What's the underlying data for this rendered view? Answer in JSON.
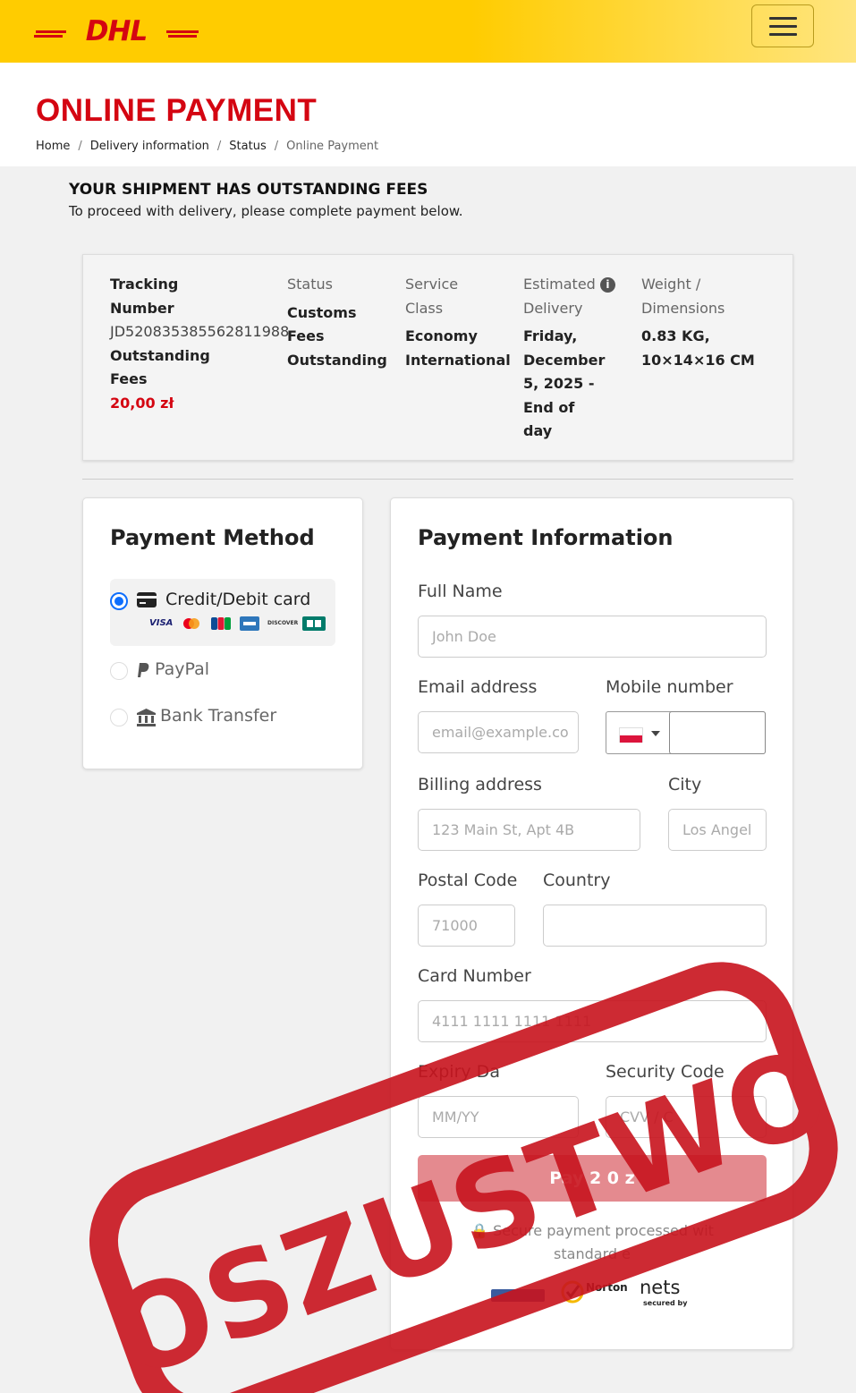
{
  "header": {
    "logo_text": "DHL",
    "menu_icon": "hamburger-icon"
  },
  "page": {
    "title": "ONLINE PAYMENT",
    "breadcrumb": [
      "Home",
      "Delivery information",
      "Status",
      "Online Payment"
    ]
  },
  "notice": {
    "title": "YOUR SHIPMENT HAS OUTSTANDING FEES",
    "text": "To proceed with delivery, please complete payment below."
  },
  "shipment": {
    "tracking_label_1": "Tracking",
    "tracking_label_2": "Number",
    "tracking_number": "JD520835385562811988",
    "fees_label_1": "Outstanding",
    "fees_label_2": "Fees",
    "fees_value": "20,00 zł",
    "status_label": "Status",
    "status_value_1": "Customs",
    "status_value_2": "Fees",
    "status_value_3": "Outstanding",
    "service_label_1": "Service",
    "service_label_2": "Class",
    "service_value_1": "Economy",
    "service_value_2": "International",
    "delivery_label_1": "Estimated",
    "delivery_label_2": "Delivery",
    "delivery_value": [
      "Friday,",
      "December",
      "5, 2025 -",
      "End of",
      "day"
    ],
    "weight_label_1": "Weight /",
    "weight_label_2": "Dimensions",
    "weight_value_1": "0.83 KG,",
    "weight_value_2": "10×14×16 CM"
  },
  "payment_method": {
    "title": "Payment Method",
    "options": [
      {
        "label": "Credit/Debit card",
        "icon": "credit-card-icon",
        "selected": true
      },
      {
        "label": "PayPal",
        "icon": "paypal-icon",
        "selected": false
      },
      {
        "label": "Bank Transfer",
        "icon": "bank-icon",
        "selected": false
      }
    ],
    "card_brands": [
      "VISA",
      "DISCOVER"
    ]
  },
  "payment_info": {
    "title": "Payment Information",
    "full_name_label": "Full Name",
    "full_name_placeholder": "John Doe",
    "email_label": "Email address",
    "email_placeholder": "email@example.co",
    "mobile_label": "Mobile number",
    "billing_label": "Billing address",
    "billing_placeholder": "123 Main St, Apt 4B",
    "city_label": "City",
    "city_placeholder": "Los Angel",
    "postal_label": "Postal Code",
    "postal_placeholder": "71000",
    "country_label": "Country",
    "card_label": "Card Number",
    "card_placeholder": "4111 1111 1111 1111",
    "expiry_label": "Expiry Da",
    "expiry_placeholder": "MM/YY",
    "security_label": "Security Code",
    "security_placeholder": "CVV / C",
    "pay_button": "Pay 2  0 z",
    "secure_line_1": "Secure payment processed wit",
    "secure_line_2": "standard e",
    "badges": [
      "Norton",
      "nets",
      "secured by"
    ]
  },
  "stamp": {
    "text": "OSZUSTWO",
    "color": "#c8141e"
  },
  "colors": {
    "brand_yellow": "#ffcc00",
    "brand_red": "#d40511",
    "selected_blue": "#0d6efd"
  }
}
